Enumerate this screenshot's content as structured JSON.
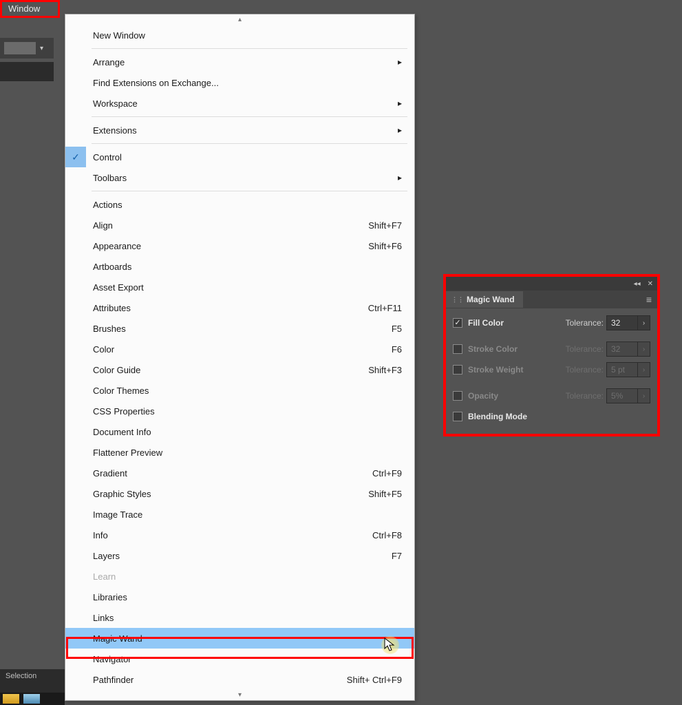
{
  "menubar": {
    "window": "Window"
  },
  "menu": {
    "new_window": "New Window",
    "arrange": "Arrange",
    "find_ext": "Find Extensions on Exchange...",
    "workspace": "Workspace",
    "extensions": "Extensions",
    "control": "Control",
    "toolbars": "Toolbars",
    "actions": "Actions",
    "align": "Align",
    "align_sc": "Shift+F7",
    "appearance": "Appearance",
    "appearance_sc": "Shift+F6",
    "artboards": "Artboards",
    "asset_export": "Asset Export",
    "attributes": "Attributes",
    "attributes_sc": "Ctrl+F11",
    "brushes": "Brushes",
    "brushes_sc": "F5",
    "color": "Color",
    "color_sc": "F6",
    "color_guide": "Color Guide",
    "color_guide_sc": "Shift+F3",
    "color_themes": "Color Themes",
    "css_props": "CSS Properties",
    "doc_info": "Document Info",
    "flatten": "Flattener Preview",
    "gradient": "Gradient",
    "gradient_sc": "Ctrl+F9",
    "graphic_styles": "Graphic Styles",
    "graphic_styles_sc": "Shift+F5",
    "image_trace": "Image Trace",
    "info": "Info",
    "info_sc": "Ctrl+F8",
    "layers": "Layers",
    "layers_sc": "F7",
    "learn": "Learn",
    "libraries": "Libraries",
    "links": "Links",
    "magic_wand": "Magic Wand",
    "navigator": "Navigator",
    "pathfinder": "Pathfinder",
    "pathfinder_sc": "Shift+ Ctrl+F9"
  },
  "selection_tab": "Selection",
  "panel": {
    "title": "Magic Wand",
    "rows": {
      "fill_color": {
        "label": "Fill Color",
        "tol_label": "Tolerance:",
        "value": "32"
      },
      "stroke_color": {
        "label": "Stroke Color",
        "tol_label": "Tolerance:",
        "value": "32"
      },
      "stroke_weight": {
        "label": "Stroke Weight",
        "tol_label": "Tolerance:",
        "value": "5 pt"
      },
      "opacity": {
        "label": "Opacity",
        "tol_label": "Tolerance:",
        "value": "5%"
      },
      "blending": {
        "label": "Blending Mode"
      }
    }
  }
}
